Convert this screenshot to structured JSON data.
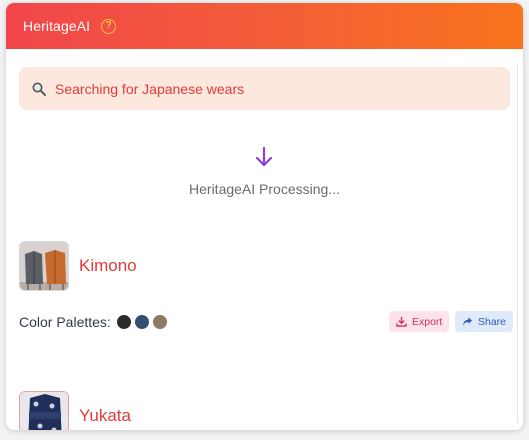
{
  "header": {
    "title": "HeritageAI",
    "help_icon": "?"
  },
  "search": {
    "icon": "search-icon",
    "query": "Searching for Japanese wears"
  },
  "status": {
    "icon": "arrow-down-icon",
    "text": "HeritageAI Processing..."
  },
  "results": [
    {
      "title": "Kimono",
      "thumbnail": "kimono-photo",
      "palette_label": "Color Palettes:",
      "palette": [
        "#2b2b2b",
        "#354f73",
        "#8b7a64"
      ],
      "export_label": "Export",
      "share_label": "Share"
    },
    {
      "title": "Yukata",
      "thumbnail": "yukata-photo"
    }
  ],
  "colors": {
    "accent": "#e23a3a",
    "header_start": "#f1454a",
    "header_end": "#f8731c",
    "arrow": "#8a3fd8"
  }
}
